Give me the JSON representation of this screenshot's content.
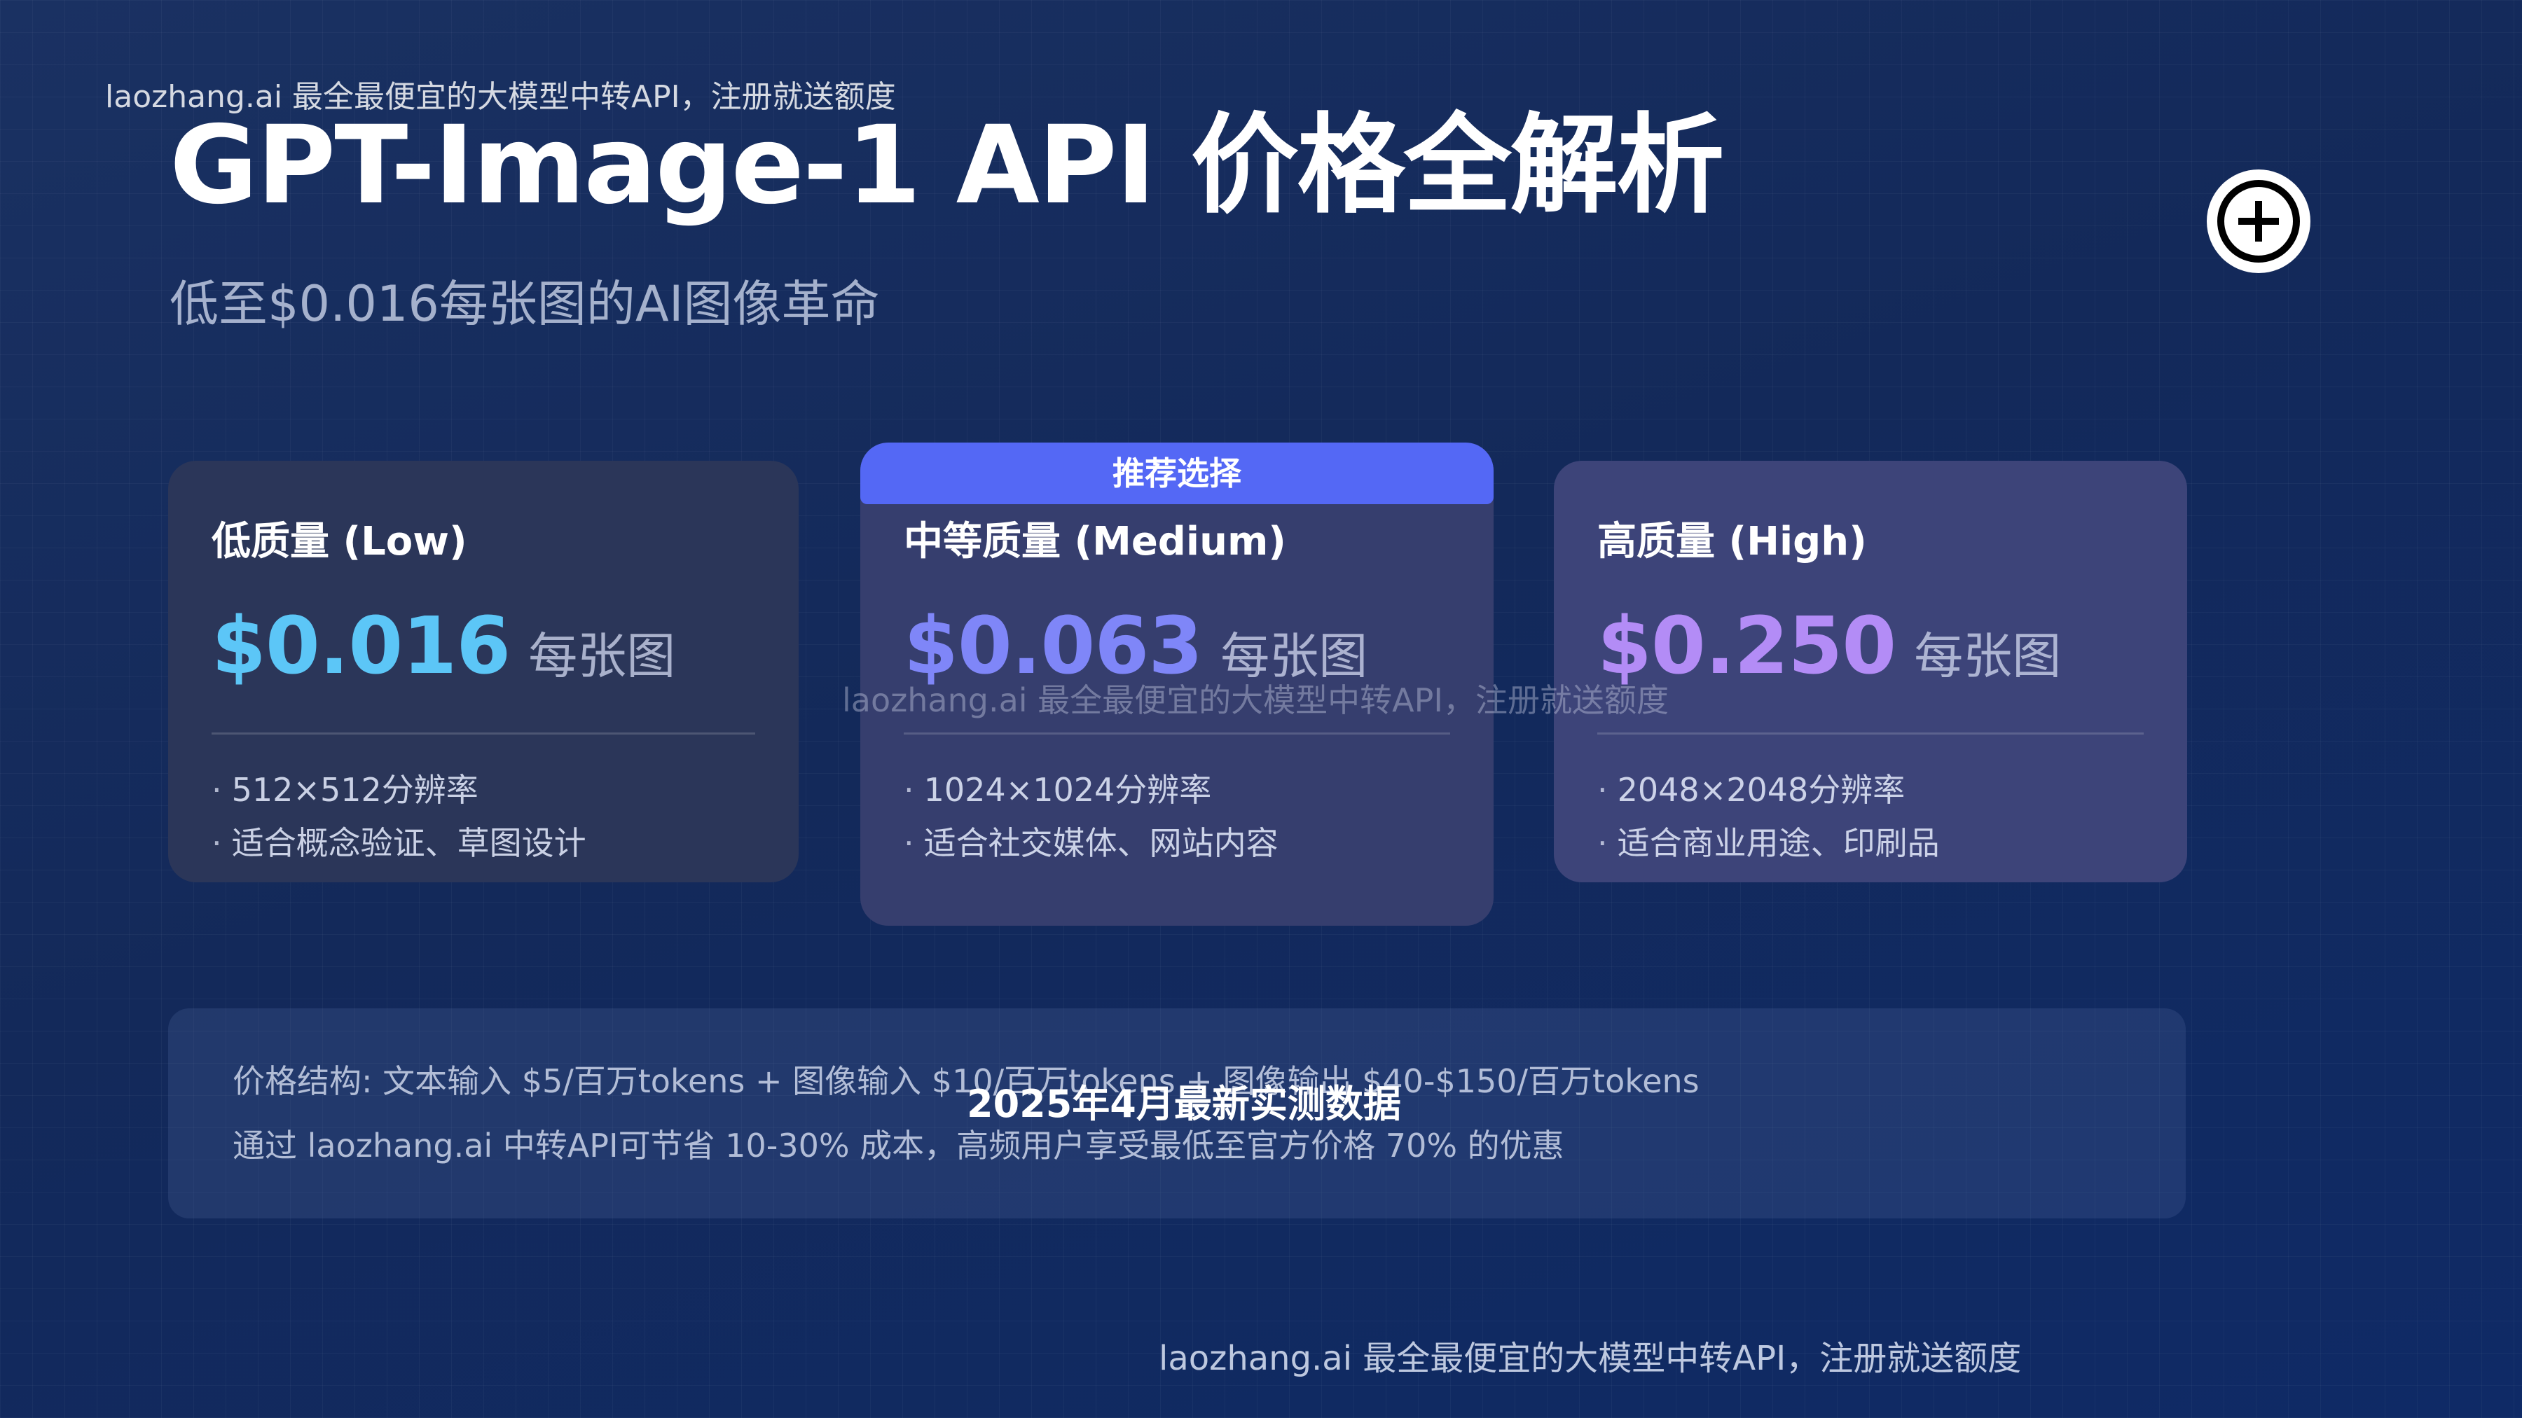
{
  "watermarks": {
    "top": "laozhang.ai 最全最便宜的大模型中转API，注册就送额度",
    "middle": "laozhang.ai 最全最便宜的大模型中转API，注册就送额度",
    "bottom": "laozhang.ai 最全最便宜的大模型中转API，注册就送额度"
  },
  "header": {
    "title": "GPT-Image-1 API 价格全解析",
    "subtitle": "低至$0.016每张图的AI图像革命"
  },
  "actions": {
    "add_icon": "plus-circle-icon"
  },
  "pricing": {
    "tiers": [
      {
        "title": "低质量 (Low)",
        "price": "$0.016",
        "unit": "每张图",
        "features": [
          "512×512分辨率",
          "适合概念验证、草图设计"
        ]
      },
      {
        "badge": "推荐选择",
        "title": "中等质量 (Medium)",
        "price": "$0.063",
        "unit": "每张图",
        "features": [
          "1024×1024分辨率",
          "适合社交媒体、网站内容"
        ]
      },
      {
        "title": "高质量 (High)",
        "price": "$0.250",
        "unit": "每张图",
        "features": [
          "2048×2048分辨率",
          "适合商业用途、印刷品"
        ]
      }
    ]
  },
  "info": {
    "line1": "价格结构: 文本输入 $5/百万tokens + 图像输入 $10/百万tokens + 图像输出 $40-$150/百万tokens",
    "line2": "通过 laozhang.ai 中转API可节省 10-30% 成本，高频用户享受最低至官方价格 70% 的优惠",
    "overlay": "2025年4月最新实测数据"
  },
  "colors": {
    "background": "#122a5e",
    "badge": "#5468f5",
    "low_price": "#5cc6f7",
    "medium_price": "#7f86f8",
    "high_price": "#b38cf6"
  }
}
